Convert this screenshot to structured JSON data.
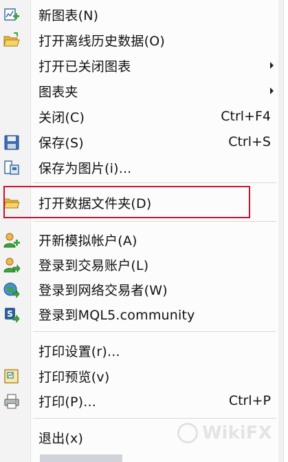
{
  "menu": {
    "items": [
      {
        "label": "新图表(N)",
        "shortcut": "",
        "icon": "new-chart-icon"
      },
      {
        "label": "打开离线历史数据(O)",
        "shortcut": "",
        "icon": "open-folder-icon"
      },
      {
        "label": "打开已关闭图表",
        "shortcut": "",
        "submenu": true
      },
      {
        "label": "图表夹",
        "shortcut": "",
        "submenu": true
      },
      {
        "label": "关闭(C)",
        "shortcut": "Ctrl+F4"
      },
      {
        "label": "保存(S)",
        "shortcut": "Ctrl+S",
        "icon": "floppy-disk-icon"
      },
      {
        "label": "保存为图片(i)...",
        "shortcut": "",
        "icon": "save-picture-icon"
      },
      {
        "label": "打开数据文件夹(D)",
        "shortcut": "",
        "icon": "folder-icon"
      },
      {
        "label": "开新模拟帐户(A)",
        "shortcut": "",
        "icon": "add-user-icon"
      },
      {
        "label": "登录到交易账户(L)",
        "shortcut": "",
        "icon": "login-user-icon"
      },
      {
        "label": "登录到网络交易者(W)",
        "shortcut": "",
        "icon": "globe-user-icon"
      },
      {
        "label": "登录到MQL5.community",
        "shortcut": "",
        "icon": "mql5-icon"
      },
      {
        "label": "打印设置(r)...",
        "shortcut": ""
      },
      {
        "label": "打印预览(v)",
        "shortcut": "",
        "icon": "print-preview-icon"
      },
      {
        "label": "打印(P)...",
        "shortcut": "Ctrl+P",
        "icon": "printer-icon"
      },
      {
        "label": "退出(x)",
        "shortcut": ""
      }
    ]
  },
  "highlight_color": "#c8102e",
  "watermark": "WikiFX"
}
